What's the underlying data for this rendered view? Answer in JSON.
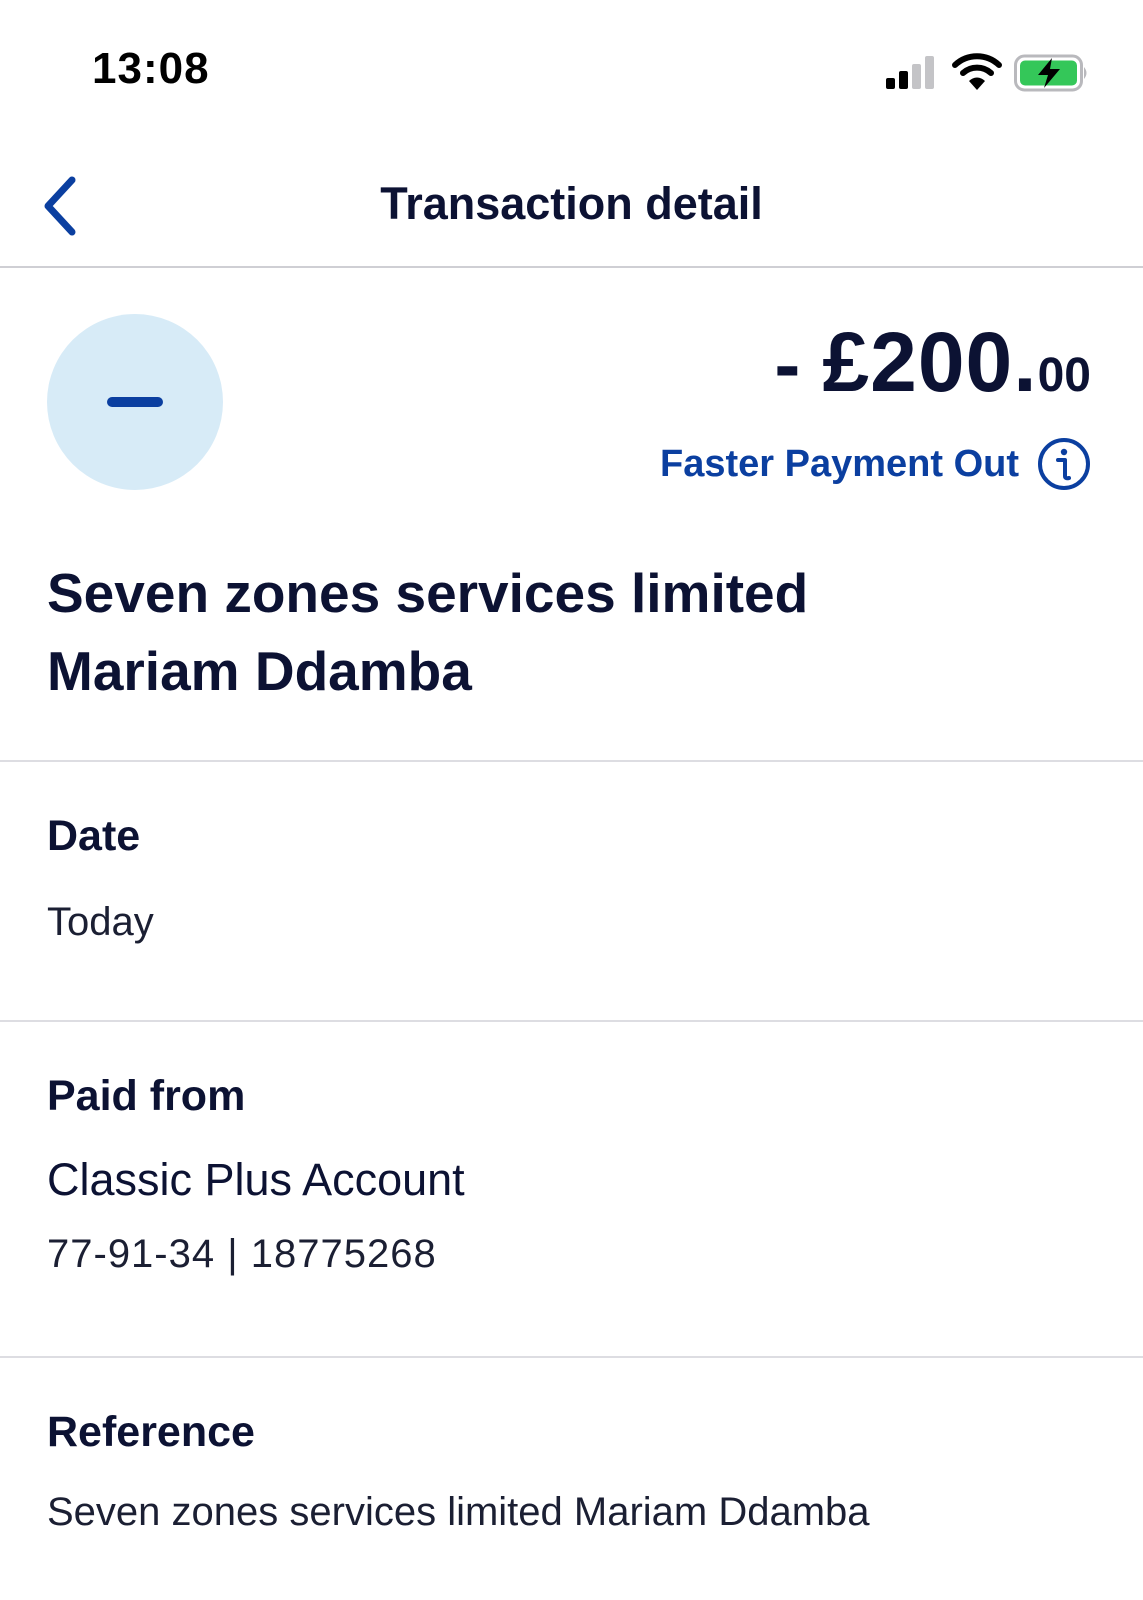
{
  "status_bar": {
    "time": "13:08",
    "signal_icon": "cellular-signal-icon",
    "wifi_icon": "wifi-icon",
    "battery_icon": "battery-charging-icon",
    "battery_color": "#34c759"
  },
  "nav": {
    "title": "Transaction detail",
    "back_icon": "chevron-left-icon"
  },
  "transaction": {
    "sign": "-",
    "currency_amount": "£200.",
    "decimals": "00",
    "type": "Faster Payment Out",
    "info_icon": "info-icon",
    "payee_line1": "Seven zones services limited",
    "payee_line2": "Mariam Ddamba"
  },
  "details": {
    "date_label": "Date",
    "date_value": "Today",
    "paid_from_label": "Paid from",
    "account_name": "Classic Plus Account",
    "account_number": "77-91-34 | 18775268",
    "reference_label": "Reference",
    "reference_value": "Seven zones services limited Mariam Ddamba"
  },
  "colors": {
    "accent": "#0b3fa0",
    "text_dark": "#0c1233",
    "avatar_bg": "#d7ebf7",
    "divider": "#dddde2"
  }
}
